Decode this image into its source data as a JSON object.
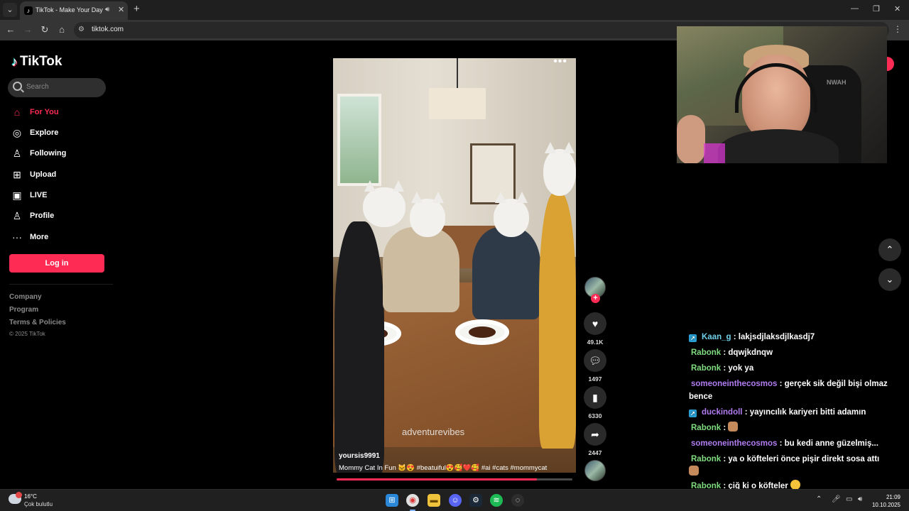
{
  "browser": {
    "tab_title": "TikTok - Make Your Day",
    "url": "tiktok.com",
    "icons": [
      "tab-search-icon",
      "tiktok-favicon",
      "speaker-icon",
      "close-tab-icon",
      "new-tab-icon",
      "back-icon",
      "forward-icon",
      "reload-icon",
      "home-icon",
      "site-info-icon",
      "menu-icon",
      "minimize-icon",
      "restore-icon",
      "close-window-icon"
    ]
  },
  "tiktok": {
    "logo": "TikTok",
    "search_placeholder": "Search",
    "nav": [
      {
        "label": "For You",
        "icon": "home-icon",
        "active": true
      },
      {
        "label": "Explore",
        "icon": "compass-icon"
      },
      {
        "label": "Following",
        "icon": "person-icon"
      },
      {
        "label": "Upload",
        "icon": "plus-square-icon"
      },
      {
        "label": "LIVE",
        "icon": "tv-icon"
      },
      {
        "label": "Profile",
        "icon": "user-icon"
      },
      {
        "label": "More",
        "icon": "ellipsis-icon"
      }
    ],
    "login_label": "Log in",
    "footer": [
      "Company",
      "Program",
      "Terms & Policies"
    ],
    "copyright": "© 2025 TikTok",
    "accent_color": "#fe2c55"
  },
  "video": {
    "watermark": "adventurevibes",
    "author": "yoursis9991",
    "caption": "Mommy Cat In Fun 🐱😍 #beatuiful😍🥰❤️🥰 #ai #cats #mommycat",
    "progress": 0.85,
    "likes": "49.1K",
    "comments": "1497",
    "saves": "6330",
    "shares": "2447"
  },
  "stream": {
    "webcam_brand": "NWAH",
    "chat": [
      {
        "badge": true,
        "nick": "Kaan_g",
        "color": "cyan",
        "text": "lakjsdjlaksdjlkasdj7"
      },
      {
        "badge": false,
        "nick": "Rabonk",
        "color": "green",
        "text": "dqwjkdnqw"
      },
      {
        "badge": false,
        "nick": "Rabonk",
        "color": "green",
        "text": "yok ya"
      },
      {
        "badge": false,
        "nick": "someoneinthecosmos",
        "color": "purple",
        "text": "gerçek sik değil bişi olmaz bence"
      },
      {
        "badge": true,
        "nick": "duckindoll",
        "color": "purple",
        "text": "yayıncılık kariyeri bitti adamın"
      },
      {
        "badge": false,
        "nick": "Rabonk",
        "color": "green",
        "text": "",
        "emote": true
      },
      {
        "badge": false,
        "nick": "someoneinthecosmos",
        "color": "purple",
        "text": "bu kedi anne güzelmiş..."
      },
      {
        "badge": false,
        "nick": "Rabonk",
        "color": "green",
        "text": "ya o köfteleri önce pişir direkt sosa attı",
        "emote": true
      },
      {
        "badge": false,
        "nick": "Rabonk",
        "color": "green",
        "text": "çiğ ki o köfteler",
        "emote": true
      }
    ]
  },
  "taskbar": {
    "temperature": "16°C",
    "condition": "Çok bulutlu",
    "time": "21:09",
    "date": "10.10.2025",
    "apps": [
      "windows-start-icon",
      "chrome-icon",
      "file-explorer-icon",
      "discord-icon",
      "steam-icon",
      "spotify-icon",
      "obs-icon"
    ]
  }
}
